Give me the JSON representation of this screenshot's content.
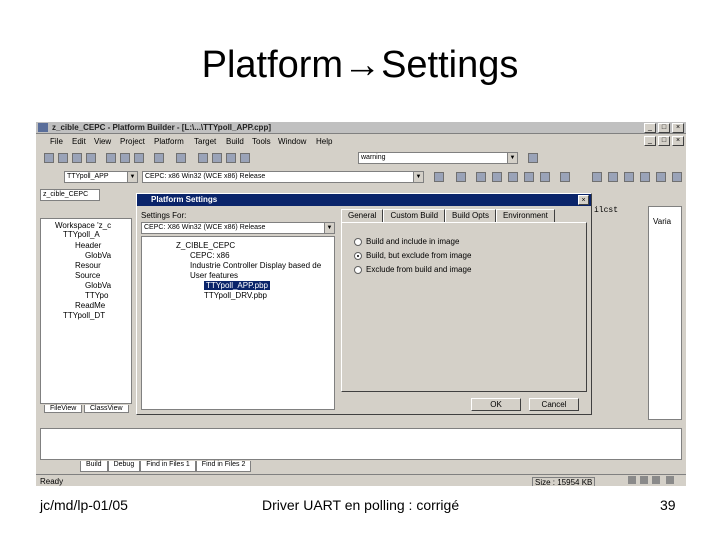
{
  "slide": {
    "title": "Platform→Settings",
    "footer_left": "jc/md/lp-01/05",
    "footer_center": "Driver UART en polling : corrigé",
    "page_number": "39"
  },
  "window": {
    "title": "z_cible_CEPC - Platform Builder - [L:\\...\\TTYpoll_APP.cpp]",
    "buttons": [
      "_",
      "□",
      "×"
    ]
  },
  "menubar": [
    "File",
    "Edit",
    "View",
    "Project",
    "Platform",
    "Target",
    "Build",
    "Tools",
    "Window",
    "Help"
  ],
  "toolbar": {
    "search_combo": "warning",
    "project_combo": "TTYpoll_APP",
    "config_combo": "CEPC: x86 Win32 (WCE x86) Release",
    "module_combo": "z_cible_CEPC"
  },
  "workspace": {
    "items": [
      "Workspace 'z_c",
      "TTYpoll_A",
      "Header",
      "GlobVa",
      "Resour",
      "Source",
      "GlobVa",
      "TTYpo",
      "ReadMe",
      "TTYpoll_DT"
    ],
    "tabs": [
      "FileView",
      "ClassView"
    ]
  },
  "editor_snippet": "ilcst",
  "right_pane": {
    "label": "Varia"
  },
  "dialog": {
    "title": "Platform Settings",
    "settings_for_label": "Settings For:",
    "settings_for_value": "CEPC: X86 Win32 (WCE x86) Release",
    "tree": [
      "Z_CIBLE_CEPC",
      "CEPC: x86",
      "Industrie Controller Display based de",
      "User features",
      "TTYpoll_APP.pbp",
      "TTYpoll_DRV.pbp"
    ],
    "tabs": [
      "General",
      "Custom Build",
      "Build Opts",
      "Environment"
    ],
    "options": [
      {
        "label": "Build and include in image",
        "selected": false
      },
      {
        "label": "Build, but exclude from image",
        "selected": true
      },
      {
        "label": "Exclude from build and image",
        "selected": false
      }
    ],
    "ok_label": "OK",
    "cancel_label": "Cancel"
  },
  "output_tabs": [
    "Build",
    "Debug",
    "Find in Files 1",
    "Find in Files 2"
  ],
  "statusbar": {
    "ready": "Ready",
    "size": "Size : 15954 KB"
  }
}
